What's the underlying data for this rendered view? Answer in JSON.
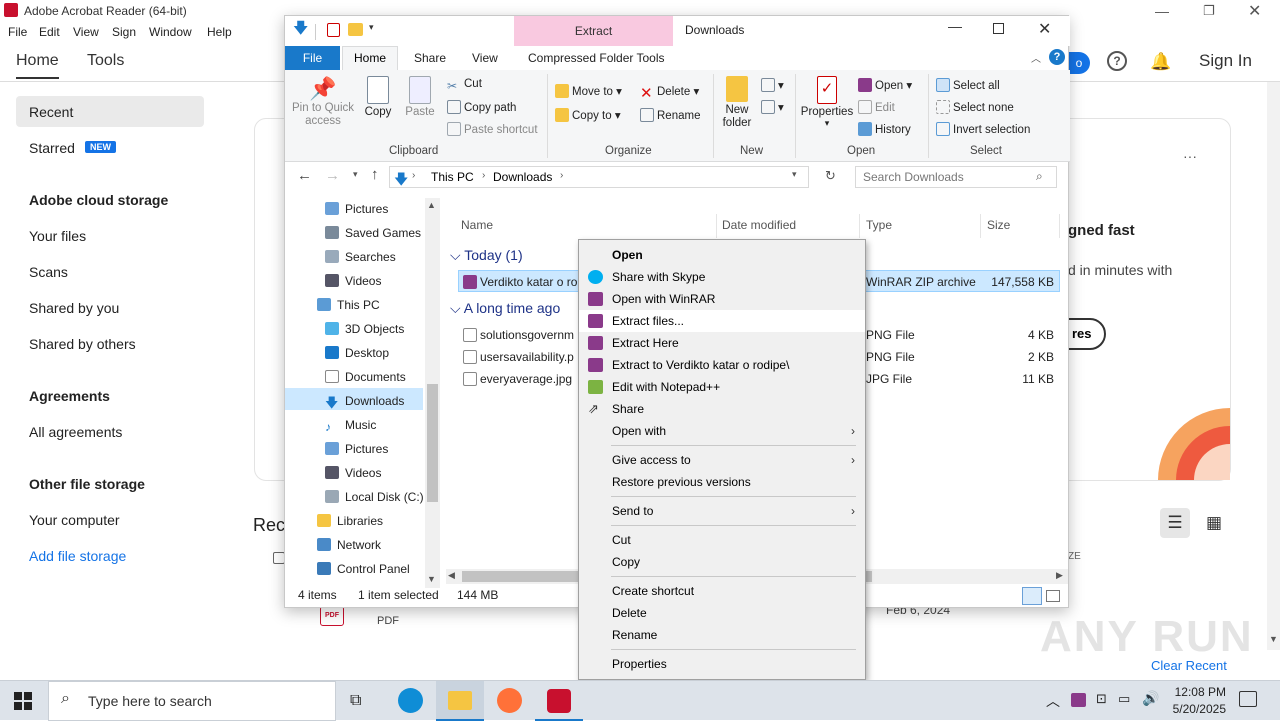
{
  "acrobat": {
    "title": "Adobe Acrobat Reader (64-bit)",
    "menu": [
      "File",
      "Edit",
      "View",
      "Sign",
      "Window",
      "Help"
    ],
    "tabs": {
      "home": "Home",
      "tools": "Tools"
    },
    "sign_in": "Sign In",
    "sidebar": {
      "recent": "Recent",
      "starred": "Starred",
      "new_badge": "NEW",
      "cloud_header": "Adobe cloud storage",
      "your_files": "Your files",
      "scans": "Scans",
      "shared_by_you": "Shared by you",
      "shared_by_others": "Shared by others",
      "agreements_header": "Agreements",
      "all_agreements": "All agreements",
      "other_header": "Other file storage",
      "your_computer": "Your computer",
      "add_storage": "Add file storage"
    },
    "card": {
      "heading": "gned fast",
      "sub": "d in minutes with",
      "btn": "res",
      "more": "···"
    },
    "recent_label": "Rec",
    "size_col": "ZE",
    "recent_file_type": "PDF",
    "recent_date": "Feb 6, 2024",
    "clear_recent": "Clear Recent",
    "watermark": "ANY RUN"
  },
  "explorer": {
    "extract_tab": "Extract",
    "window_title": "Downloads",
    "tabs": [
      "File",
      "Home",
      "Share",
      "View",
      "Compressed Folder Tools"
    ],
    "clipboard": {
      "pin": "Pin to Quick access",
      "copy": "Copy",
      "paste": "Paste",
      "cut": "Cut",
      "copy_path": "Copy path",
      "paste_shortcut": "Paste shortcut",
      "group": "Clipboard"
    },
    "organize": {
      "move_to": "Move to",
      "copy_to": "Copy to",
      "delete": "Delete",
      "rename": "Rename",
      "group": "Organize"
    },
    "new": {
      "new_folder": "New folder",
      "group": "New"
    },
    "open": {
      "properties": "Properties",
      "open": "Open",
      "edit": "Edit",
      "history": "History",
      "group": "Open"
    },
    "select": {
      "select_all": "Select all",
      "select_none": "Select none",
      "invert": "Invert selection",
      "group": "Select"
    },
    "address": {
      "this_pc": "This PC",
      "downloads": "Downloads"
    },
    "search_placeholder": "Search Downloads",
    "nav": [
      "Pictures",
      "Saved Games",
      "Searches",
      "Videos",
      "This PC",
      "3D Objects",
      "Desktop",
      "Documents",
      "Downloads",
      "Music",
      "Pictures",
      "Videos",
      "Local Disk (C:)",
      "Libraries",
      "Network",
      "Control Panel"
    ],
    "columns": {
      "name": "Name",
      "date": "Date modified",
      "type": "Type",
      "size": "Size"
    },
    "groups": {
      "today": "Today (1)",
      "long_ago": "A long time ago"
    },
    "files": [
      {
        "name": "Verdikto katar o ro",
        "type": "WinRAR ZIP archive",
        "size": "147,558 KB"
      },
      {
        "name": "solutionsgovernm",
        "type": "PNG File",
        "size": "4 KB"
      },
      {
        "name": "usersavailability.p",
        "type": "PNG File",
        "size": "2 KB"
      },
      {
        "name": "everyaverage.jpg",
        "type": "JPG File",
        "size": "11 KB"
      }
    ],
    "status": {
      "items": "4 items",
      "selected": "1 item selected",
      "size": "144 MB"
    }
  },
  "context_menu": [
    "Open",
    "Share with Skype",
    "Open with WinRAR",
    "Extract files...",
    "Extract Here",
    "Extract to Verdikto katar o rodipe\\",
    "Edit with Notepad++",
    "Share",
    "Open with",
    "Give access to",
    "Restore previous versions",
    "Send to",
    "Cut",
    "Copy",
    "Create shortcut",
    "Delete",
    "Rename",
    "Properties"
  ],
  "taskbar": {
    "search": "Type here to search",
    "time": "12:08 PM",
    "date": "5/20/2025"
  },
  "colors": {
    "adobe_red": "#c8102e",
    "explorer_blue": "#1979ca",
    "selection": "#cce8ff",
    "extract_pink": "#f9c9e0"
  }
}
